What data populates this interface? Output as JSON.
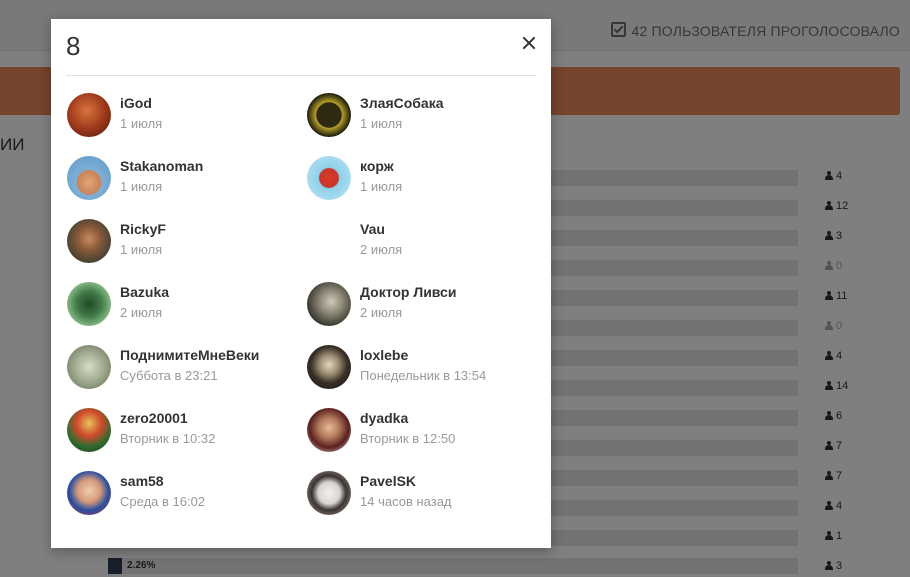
{
  "page": {
    "votes_summary": "42 ПОЛЬЗОВАТЕЛЯ ПРОГОЛОСОВАЛО",
    "heading_fragment": "ИИ",
    "answer_counts": [
      "4",
      "12",
      "3",
      "0",
      "11",
      "0",
      "4",
      "14",
      "6",
      "7",
      "7",
      "4",
      "1",
      "3"
    ],
    "last_percent": "2.26%"
  },
  "modal": {
    "title": "8",
    "voters": [
      {
        "name": "iGod",
        "date": "1 июля"
      },
      {
        "name": "ЗлаяСобака",
        "date": "1 июля"
      },
      {
        "name": "Stakanoman",
        "date": "1 июля"
      },
      {
        "name": "корж",
        "date": "1 июля"
      },
      {
        "name": "RickyF",
        "date": "1 июля"
      },
      {
        "name": "Vau",
        "date": "2 июля"
      },
      {
        "name": "Bazuka",
        "date": "2 июля"
      },
      {
        "name": "Доктор Ливси",
        "date": "2 июля"
      },
      {
        "name": "ПоднимитеМнеВеки",
        "date": "Суббота в 23:21"
      },
      {
        "name": "loxlebe",
        "date": "Понедельник в 13:54"
      },
      {
        "name": "zero20001",
        "date": "Вторник в 10:32"
      },
      {
        "name": "dyadka",
        "date": "Вторник в 12:50"
      },
      {
        "name": "sam58",
        "date": "Среда в 16:02"
      },
      {
        "name": "PavelSK",
        "date": "14 часов назад"
      }
    ]
  }
}
